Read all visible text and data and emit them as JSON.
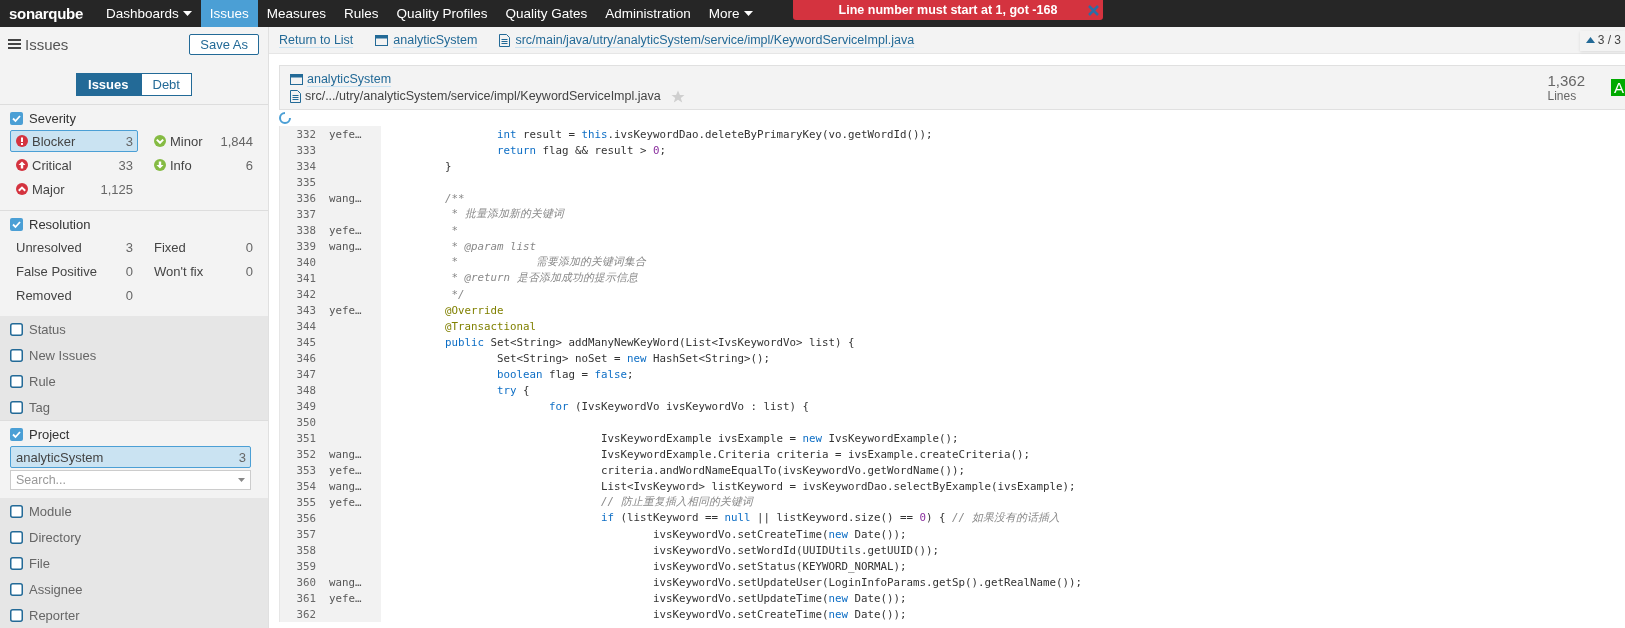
{
  "nav": {
    "logo": "sonarqube",
    "items": [
      {
        "label": "Dashboards",
        "selected": false,
        "dropdown": true
      },
      {
        "label": "Issues",
        "selected": true,
        "dropdown": false
      },
      {
        "label": "Measures",
        "selected": false,
        "dropdown": false
      },
      {
        "label": "Rules",
        "selected": false,
        "dropdown": false
      },
      {
        "label": "Quality Profiles",
        "selected": false,
        "dropdown": false
      },
      {
        "label": "Quality Gates",
        "selected": false,
        "dropdown": false
      },
      {
        "label": "Administration",
        "selected": false,
        "dropdown": false
      },
      {
        "label": "More",
        "selected": false,
        "dropdown": true
      }
    ]
  },
  "notification": {
    "message": "Line number must start at 1, got -168"
  },
  "sidebar": {
    "title": "Issues",
    "save_as": "Save As",
    "mode_toggle": [
      {
        "label": "Issues",
        "selected": true
      },
      {
        "label": "Debt",
        "selected": false
      }
    ],
    "facets": [
      {
        "kind": "severity",
        "title": "Severity",
        "checked": true,
        "items": [
          {
            "kind": "blocker",
            "label": "Blocker",
            "count": "3",
            "selected": true
          },
          {
            "kind": "minor",
            "label": "Minor",
            "count": "1,844",
            "selected": false
          },
          {
            "kind": "critical",
            "label": "Critical",
            "count": "33",
            "selected": false
          },
          {
            "kind": "info",
            "label": "Info",
            "count": "6",
            "selected": false
          },
          {
            "kind": "major",
            "label": "Major",
            "count": "1,125",
            "selected": false
          }
        ]
      },
      {
        "kind": "resolution",
        "title": "Resolution",
        "checked": true,
        "items": [
          {
            "label": "Unresolved",
            "count": "3",
            "selected": false
          },
          {
            "label": "Fixed",
            "count": "0",
            "selected": false
          },
          {
            "label": "False Positive",
            "count": "0",
            "selected": false
          },
          {
            "label": "Won't fix",
            "count": "0",
            "selected": false
          },
          {
            "label": "Removed",
            "count": "0",
            "selected": false
          }
        ]
      },
      {
        "kind": "plain",
        "title": "Status",
        "checked": false
      },
      {
        "kind": "plain",
        "title": "New Issues",
        "checked": false
      },
      {
        "kind": "plain",
        "title": "Rule",
        "checked": false
      },
      {
        "kind": "plain",
        "title": "Tag",
        "checked": false
      },
      {
        "kind": "project",
        "title": "Project",
        "checked": true,
        "items": [
          {
            "label": "analyticSystem",
            "count": "3",
            "selected": true
          }
        ],
        "search_placeholder": "Search..."
      },
      {
        "kind": "plain",
        "title": "Module",
        "checked": false
      },
      {
        "kind": "plain",
        "title": "Directory",
        "checked": false
      },
      {
        "kind": "plain",
        "title": "File",
        "checked": false
      },
      {
        "kind": "plain",
        "title": "Assignee",
        "checked": false
      },
      {
        "kind": "plain",
        "title": "Reporter",
        "checked": false
      }
    ]
  },
  "breadcrumbs": {
    "return_link": "Return to List",
    "project": "analyticSystem",
    "file": "src/main/java/utry/analyticSystem/service/impl/KeywordServiceImpl.java",
    "position": "3 / 3"
  },
  "component_header": {
    "project": "analyticSystem",
    "path": "src/.../utry/analyticSystem/service/impl/KeywordServiceImpl.java",
    "favorite": false,
    "lines_value": "1,362",
    "lines_label": "Lines",
    "rating": "A"
  },
  "code_lines": [
    {
      "number": "332",
      "author": "yefe…",
      "segments": [
        {
          "kind": "keyword",
          "text": "\t\tint"
        },
        {
          "kind": "plain",
          "text": " result = "
        },
        {
          "kind": "keyword",
          "text": "this"
        },
        {
          "kind": "plain",
          "text": ".ivsKeywordDao.deleteByPrimaryKey(vo.getWordId());"
        }
      ]
    },
    {
      "number": "333",
      "segments": [
        {
          "kind": "keyword",
          "text": "\t\treturn"
        },
        {
          "kind": "plain",
          "text": " flag && result > "
        },
        {
          "kind": "number",
          "text": "0"
        },
        {
          "kind": "plain",
          "text": ";"
        }
      ]
    },
    {
      "number": "334",
      "segments": [
        {
          "kind": "plain",
          "text": "\t}"
        }
      ]
    },
    {
      "number": "335"
    },
    {
      "number": "336",
      "author": "wang…",
      "segments": [
        {
          "kind": "comment",
          "text": "\t/**"
        }
      ]
    },
    {
      "number": "337",
      "segments": [
        {
          "kind": "comment",
          "text": "\t * 批量添加新的关键词"
        }
      ]
    },
    {
      "number": "338",
      "author": "yefe…",
      "segments": [
        {
          "kind": "comment",
          "text": "\t *"
        }
      ]
    },
    {
      "number": "339",
      "author": "wang…",
      "segments": [
        {
          "kind": "comment",
          "text": "\t * @param list"
        }
      ]
    },
    {
      "number": "340",
      "segments": [
        {
          "kind": "comment",
          "text": "\t *            需要添加的关键词集合"
        }
      ]
    },
    {
      "number": "341",
      "segments": [
        {
          "kind": "comment",
          "text": "\t * @return 是否添加成功的提示信息"
        }
      ]
    },
    {
      "number": "342",
      "segments": [
        {
          "kind": "comment",
          "text": "\t */"
        }
      ]
    },
    {
      "number": "343",
      "author": "yefe…",
      "segments": [
        {
          "kind": "annotation",
          "text": "\t@Override"
        }
      ]
    },
    {
      "number": "344",
      "segments": [
        {
          "kind": "annotation",
          "text": "\t@Transactional"
        }
      ]
    },
    {
      "number": "345",
      "segments": [
        {
          "kind": "keyword",
          "text": "\tpublic"
        },
        {
          "kind": "plain",
          "text": " Set<String> addManyNewKeyWord(List<IvsKeywordVo> list) {"
        }
      ]
    },
    {
      "number": "346",
      "segments": [
        {
          "kind": "plain",
          "text": "\t\tSet<String> noSet = "
        },
        {
          "kind": "keyword",
          "text": "new"
        },
        {
          "kind": "plain",
          "text": " HashSet<String>();"
        }
      ]
    },
    {
      "number": "347",
      "segments": [
        {
          "kind": "keyword",
          "text": "\t\tboolean"
        },
        {
          "kind": "plain",
          "text": " flag = "
        },
        {
          "kind": "keyword",
          "text": "false"
        },
        {
          "kind": "plain",
          "text": ";"
        }
      ]
    },
    {
      "number": "348",
      "segments": [
        {
          "kind": "keyword",
          "text": "\t\ttry"
        },
        {
          "kind": "plain",
          "text": " {"
        }
      ]
    },
    {
      "number": "349",
      "segments": [
        {
          "kind": "keyword",
          "text": "\t\t\tfor"
        },
        {
          "kind": "plain",
          "text": " (IvsKeywordVo ivsKeywordVo : list) {"
        }
      ]
    },
    {
      "number": "350"
    },
    {
      "number": "351",
      "segments": [
        {
          "kind": "plain",
          "text": "\t\t\t\tIvsKeywordExample ivsExample = "
        },
        {
          "kind": "keyword",
          "text": "new"
        },
        {
          "kind": "plain",
          "text": " IvsKeywordExample();"
        }
      ]
    },
    {
      "number": "352",
      "author": "wang…",
      "segments": [
        {
          "kind": "plain",
          "text": "\t\t\t\tIvsKeywordExample.Criteria criteria = ivsExample.createCriteria();"
        }
      ]
    },
    {
      "number": "353",
      "author": "yefe…",
      "segments": [
        {
          "kind": "plain",
          "text": "\t\t\t\tcriteria.andWordNameEqualTo(ivsKeywordVo.getWordName());"
        }
      ]
    },
    {
      "number": "354",
      "author": "wang…",
      "segments": [
        {
          "kind": "plain",
          "text": "\t\t\t\tList<IvsKeyword> listKeyword = ivsKeywordDao.selectByExample(ivsExample);"
        }
      ]
    },
    {
      "number": "355",
      "author": "yefe…",
      "segments": [
        {
          "kind": "comment",
          "text": "\t\t\t\t// 防止重复插入相同的关键词"
        }
      ]
    },
    {
      "number": "356",
      "segments": [
        {
          "kind": "keyword",
          "text": "\t\t\t\tif"
        },
        {
          "kind": "plain",
          "text": " (listKeyword == "
        },
        {
          "kind": "keyword",
          "text": "null"
        },
        {
          "kind": "plain",
          "text": " || listKeyword.size() == "
        },
        {
          "kind": "number",
          "text": "0"
        },
        {
          "kind": "plain",
          "text": ") { "
        },
        {
          "kind": "comment",
          "text": "// 如果没有的话插入"
        }
      ]
    },
    {
      "number": "357",
      "segments": [
        {
          "kind": "plain",
          "text": "\t\t\t\t\tivsKeywordVo.setCreateTime("
        },
        {
          "kind": "keyword",
          "text": "new"
        },
        {
          "kind": "plain",
          "text": " Date());"
        }
      ]
    },
    {
      "number": "358",
      "segments": [
        {
          "kind": "plain",
          "text": "\t\t\t\t\tivsKeywordVo.setWordId(UUIDUtils.getUUID());"
        }
      ]
    },
    {
      "number": "359",
      "segments": [
        {
          "kind": "plain",
          "text": "\t\t\t\t\tivsKeywordVo.setStatus(KEYWORD_NORMAL);"
        }
      ]
    },
    {
      "number": "360",
      "author": "wang…",
      "segments": [
        {
          "kind": "plain",
          "text": "\t\t\t\t\tivsKeywordVo.setUpdateUser(LoginInfoParams.getSp().getRealName());"
        }
      ]
    },
    {
      "number": "361",
      "author": "yefe…",
      "segments": [
        {
          "kind": "plain",
          "text": "\t\t\t\t\tivsKeywordVo.setUpdateTime("
        },
        {
          "kind": "keyword",
          "text": "new"
        },
        {
          "kind": "plain",
          "text": " Date());"
        }
      ]
    },
    {
      "number": "362",
      "segments": [
        {
          "kind": "plain",
          "text": "\t\t\t\t\tivsKeywordVo.setCreateTime("
        },
        {
          "kind": "keyword",
          "text": "new"
        },
        {
          "kind": "plain",
          "text": " Date());"
        }
      ]
    }
  ]
}
